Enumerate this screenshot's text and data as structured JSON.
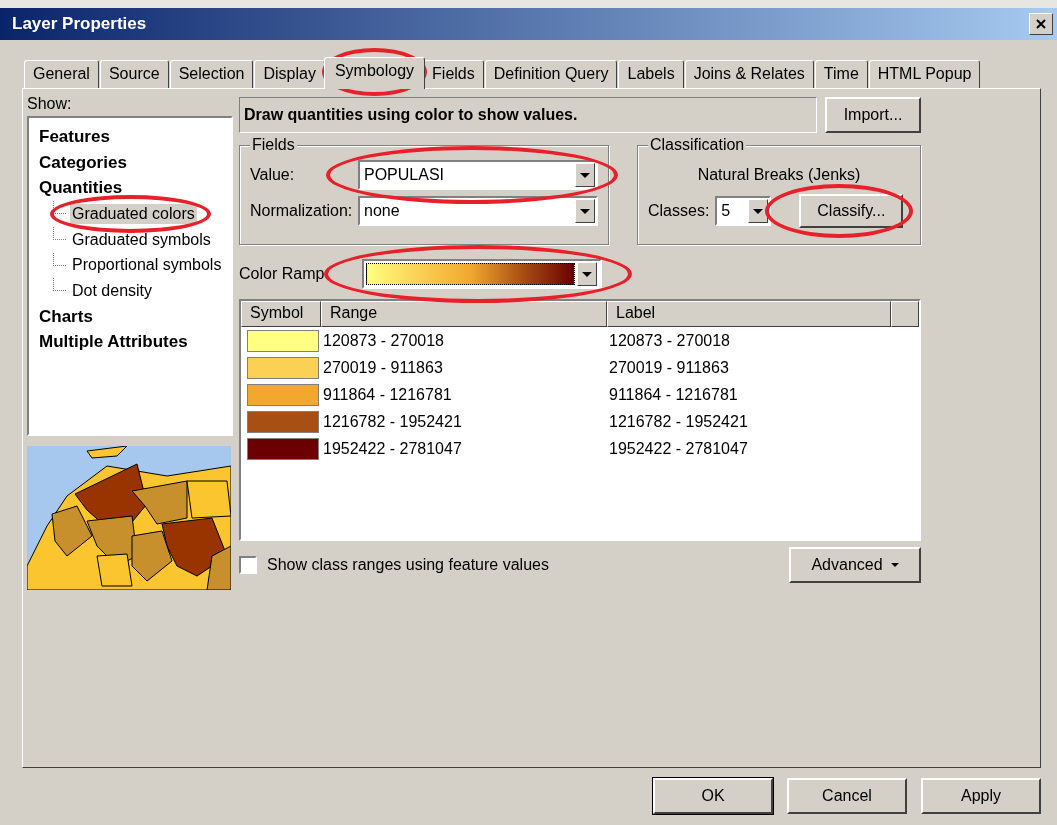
{
  "window": {
    "title": "Layer Properties"
  },
  "tabs": [
    {
      "label": "General",
      "selected": false
    },
    {
      "label": "Source",
      "selected": false
    },
    {
      "label": "Selection",
      "selected": false
    },
    {
      "label": "Display",
      "selected": false
    },
    {
      "label": "Symbology",
      "selected": true,
      "circled": true
    },
    {
      "label": "Fields",
      "selected": false
    },
    {
      "label": "Definition Query",
      "selected": false
    },
    {
      "label": "Labels",
      "selected": false
    },
    {
      "label": "Joins & Relates",
      "selected": false
    },
    {
      "label": "Time",
      "selected": false
    },
    {
      "label": "HTML Popup",
      "selected": false
    }
  ],
  "show": {
    "label": "Show:",
    "items": [
      {
        "label": "Features",
        "selected": false
      },
      {
        "label": "Categories",
        "selected": false
      },
      {
        "label": "Quantities",
        "selected": false,
        "children": [
          {
            "label": "Graduated colors",
            "selected": true,
            "circled": true
          },
          {
            "label": "Graduated symbols",
            "selected": false
          },
          {
            "label": "Proportional symbols",
            "selected": false
          },
          {
            "label": "Dot density",
            "selected": false
          }
        ]
      },
      {
        "label": "Charts",
        "selected": false
      },
      {
        "label": "Multiple Attributes",
        "selected": false
      }
    ]
  },
  "description": "Draw quantities using color to show values.",
  "import_button": "Import...",
  "fields": {
    "title": "Fields",
    "value": {
      "label": "Value:",
      "value": "POPULASI",
      "circled": true
    },
    "normalization": {
      "label": "Normalization:",
      "value": "none"
    }
  },
  "classification": {
    "title": "Classification",
    "method": "Natural Breaks (Jenks)",
    "classes_label": "Classes:",
    "classes_value": "5",
    "classify_button": {
      "label": "Classify...",
      "circled": true
    }
  },
  "color_ramp": {
    "label": "Color Ramp",
    "circled": true
  },
  "table": {
    "columns": [
      "Symbol",
      "Range",
      "Label"
    ],
    "rows": [
      {
        "color": "#ffff80",
        "range": "120873 - 270018",
        "label": "120873 - 270018"
      },
      {
        "color": "#fad155",
        "range": "270019 - 911863",
        "label": "270019 - 911863"
      },
      {
        "color": "#f2a72f",
        "range": "911864 - 1216781",
        "label": "911864 - 1216781"
      },
      {
        "color": "#a84f14",
        "range": "1216782 - 1952421",
        "label": "1216782 - 1952421"
      },
      {
        "color": "#6b0000",
        "range": "1952422 - 2781047",
        "label": "1952422 - 2781047"
      }
    ]
  },
  "checkbox": {
    "label": "Show class ranges using feature values",
    "checked": false
  },
  "advanced_button": "Advanced",
  "buttons": [
    {
      "label": "OK",
      "default": true
    },
    {
      "label": "Cancel",
      "default": false
    },
    {
      "label": "Apply",
      "default": false
    }
  ]
}
